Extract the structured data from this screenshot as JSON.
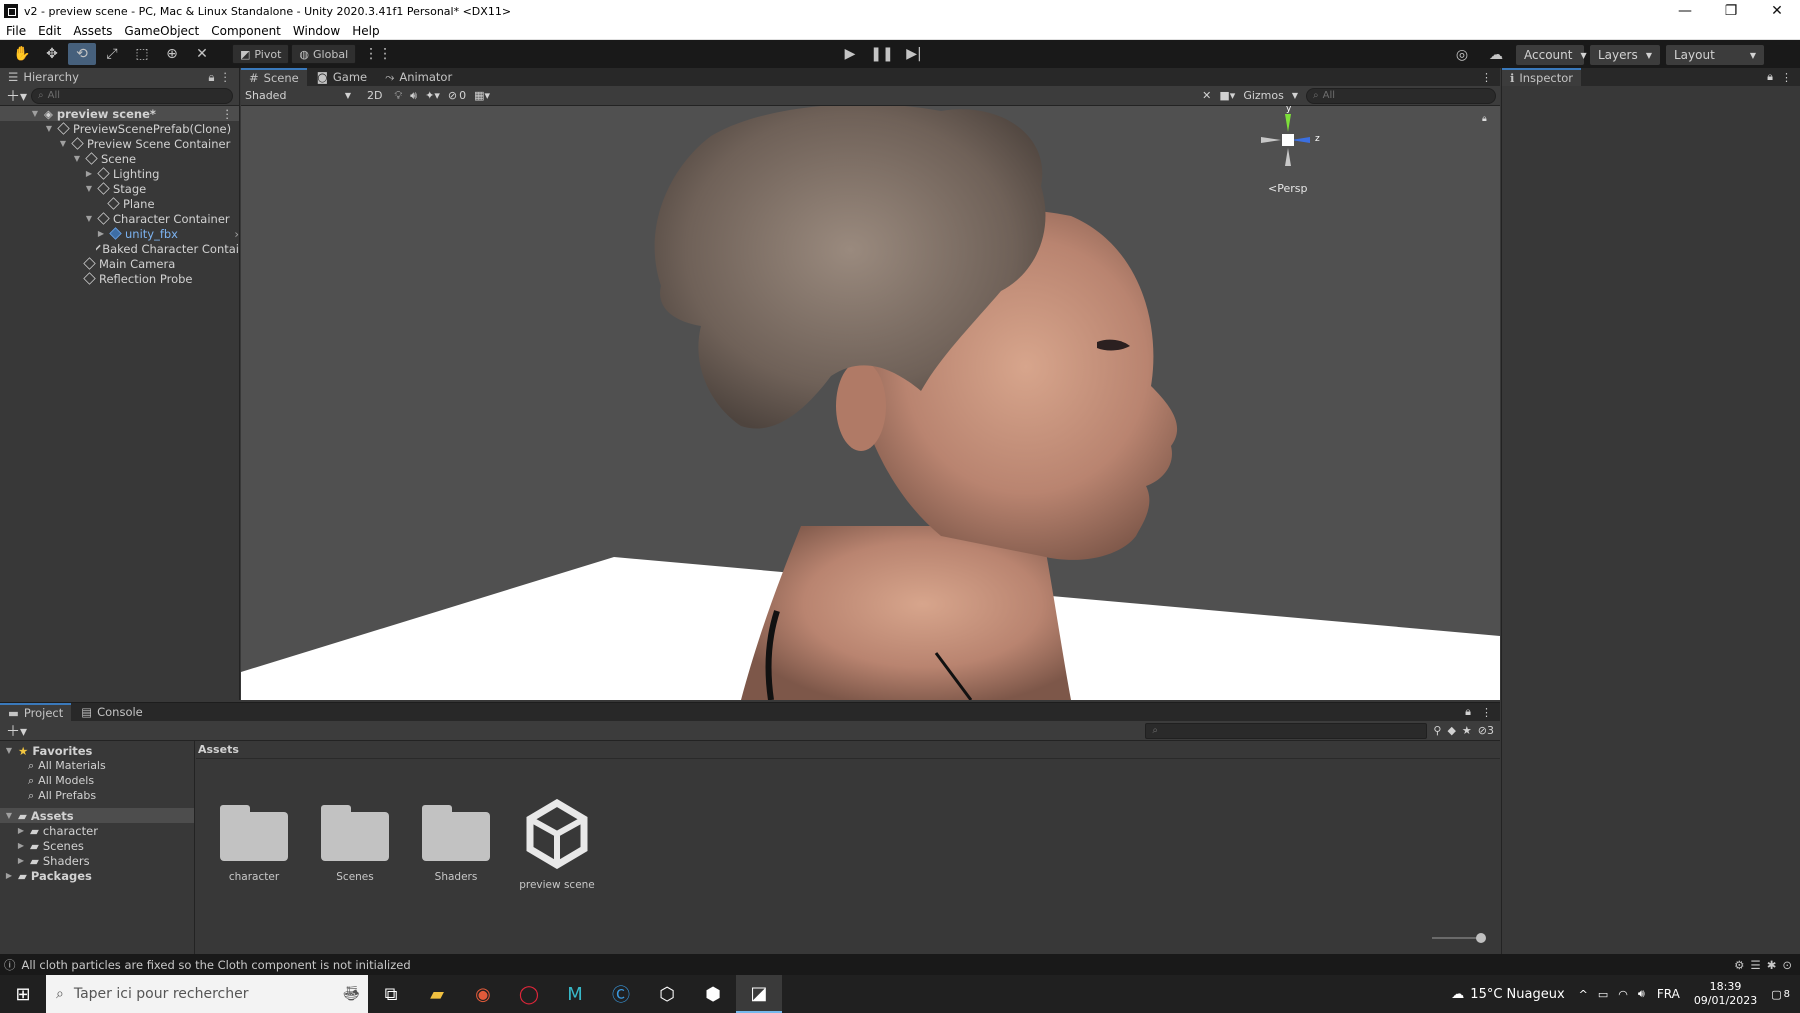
{
  "window": {
    "title": "v2 - preview scene - PC, Mac & Linux Standalone - Unity 2020.3.41f1 Personal* <DX11>",
    "minimize": "—",
    "restore": "❐",
    "close": "✕"
  },
  "menu": [
    "File",
    "Edit",
    "Assets",
    "GameObject",
    "Component",
    "Window",
    "Help"
  ],
  "toolbar": {
    "pivot": "Pivot",
    "global": "Global",
    "account": "Account",
    "layers": "Layers",
    "layout": "Layout"
  },
  "hierarchy": {
    "tab": "Hierarchy",
    "search_placeholder": "All",
    "items": [
      {
        "label": "preview scene*"
      },
      {
        "label": "PreviewScenePrefab(Clone)"
      },
      {
        "label": "Preview Scene Container"
      },
      {
        "label": "Scene"
      },
      {
        "label": "Lighting"
      },
      {
        "label": "Stage"
      },
      {
        "label": "Plane"
      },
      {
        "label": "Character Container"
      },
      {
        "label": "unity_fbx"
      },
      {
        "label": "Baked Character Contai"
      },
      {
        "label": "Main Camera"
      },
      {
        "label": "Reflection Probe"
      }
    ]
  },
  "scene": {
    "tabs": [
      "Scene",
      "Game",
      "Animator"
    ],
    "shading_mode": "Shaded",
    "mode_2d": "2D",
    "hidden_count": "0",
    "gizmos": "Gizmos",
    "search_placeholder": "All",
    "gizmo_y": "y",
    "gizmo_z": "z",
    "projection": "Persp"
  },
  "inspector": {
    "tab": "Inspector"
  },
  "project": {
    "tabs": [
      "Project",
      "Console"
    ],
    "favorites_label": "Favorites",
    "favorites": [
      "All Materials",
      "All Models",
      "All Prefabs"
    ],
    "assets_label": "Assets",
    "asset_folders": [
      "character",
      "Scenes",
      "Shaders"
    ],
    "packages_label": "Packages",
    "breadcrumb": "Assets",
    "items": [
      "character",
      "Scenes",
      "Shaders",
      "preview scene"
    ],
    "hidden_count": "3"
  },
  "status": {
    "message": "All cloth particles are fixed so the Cloth component is not initialized"
  },
  "taskbar": {
    "search_placeholder": "Taper ici pour rechercher",
    "weather": "15°C  Nuageux",
    "language": "FRA",
    "time": "18:39",
    "date": "09/01/2023",
    "notification_count": "8"
  },
  "colors": {
    "accent": "#3a79bb",
    "panel": "#383838",
    "toolbar": "#191919",
    "viewport_bg": "#505050"
  }
}
